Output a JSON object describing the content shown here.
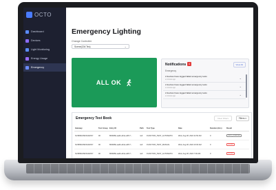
{
  "app": {
    "logo_text": "OCTO"
  },
  "sidebar": {
    "items": [
      {
        "label": "Dashboard",
        "icon": "dashboard-icon",
        "color": "#5b8cff"
      },
      {
        "label": "Devices",
        "icon": "devices-icon",
        "color": "#8b6cff"
      },
      {
        "label": "Light Monitoring",
        "icon": "light-icon",
        "color": "#5b8cff"
      },
      {
        "label": "Energy Usage",
        "icon": "energy-icon",
        "color": "#9a6cff"
      },
      {
        "label": "Emergency",
        "icon": "emergency-icon",
        "color": "#6c8cff"
      }
    ]
  },
  "page": {
    "title": "Emergency Lighting",
    "controller_label": "Change Controller",
    "controller_value": "Scene(CM-Tec)"
  },
  "status": {
    "text": "ALL OK",
    "color": "#1b9a58"
  },
  "notifications": {
    "title": "Notifications",
    "badge": "4",
    "view_all": "View All",
    "filter": "Emergency",
    "items": [
      {
        "main": "2 devices have logged failed emergency tests",
        "sub": "a minute ago"
      },
      {
        "main": "2 devices have logged failed emergency tests",
        "sub": "a minute ago"
      },
      {
        "main": "2 devices have logged failed emergency tests",
        "sub": "a minute ago"
      }
    ]
  },
  "test_book": {
    "title": "Emergency Test Book",
    "clear_label": "Clear Filters",
    "filters_label": "Filters",
    "columns": [
      "Gateway",
      "Test Group",
      "Entry ID",
      "Path",
      "Test Type",
      "Date",
      "Duration (Hrs)",
      "Result"
    ],
    "rows": [
      [
        "NV4BSD2SKWH3JWY",
        "90",
        "8f4638fe-aa4b-a61e-a6ff-7...",
        "null",
        "FUNCTION_TEST_AUTOMATIC",
        "Wed, Aug 28, 2024 11:50 AM",
        "0",
        "TEST_STARTED"
      ],
      [
        "NV4BSD2SKWH3JWY",
        "90",
        "8f4638fe-aa4b-a61e-a6ff-7...",
        "null",
        "FUNCTION_TEST_MANUAL",
        "Wed, Aug 28, 2024 10:00 AM",
        "0",
        "FAILED"
      ],
      [
        "NV4BSD2SKWH3JWY",
        "90",
        "8f4638fe-aa4b-a61e-a6ff-7...",
        "null",
        "FUNCTION_TEST_AUTOMATIC",
        "Wed, Aug 28, 2024 7:00 AM",
        "0",
        "FAILED"
      ]
    ]
  }
}
